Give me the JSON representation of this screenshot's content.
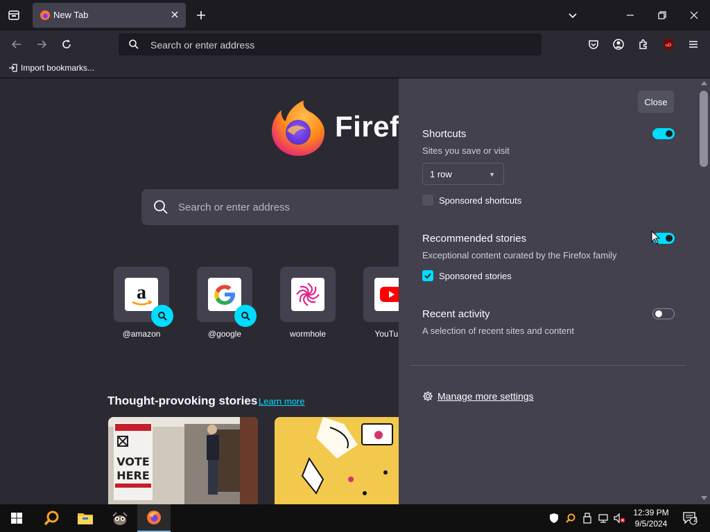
{
  "tab": {
    "title": "New Tab"
  },
  "urlbar": {
    "placeholder": "Search or enter address"
  },
  "bookmarks": {
    "import_label": "Import bookmarks..."
  },
  "newtab": {
    "brand": "Firefox",
    "search_placeholder": "Search or enter address",
    "shortcuts": [
      {
        "label": "@amazon",
        "icon": "amazon-logo"
      },
      {
        "label": "@google",
        "icon": "google-logo"
      },
      {
        "label": "wormhole",
        "icon": "wormhole-logo"
      },
      {
        "label": "YouTube",
        "icon": "youtube-logo"
      }
    ],
    "stories": {
      "title": "Thought-provoking stories",
      "learn_more": "Learn more"
    }
  },
  "panel": {
    "close_label": "Close",
    "shortcuts": {
      "title": "Shortcuts",
      "subtitle": "Sites you save or visit",
      "rows_value": "1 row",
      "enabled": true,
      "sponsored_label": "Sponsored shortcuts",
      "sponsored_checked": false
    },
    "recommended": {
      "title": "Recommended stories",
      "subtitle": "Exceptional content curated by the Firefox family",
      "enabled": true,
      "sponsored_label": "Sponsored stories",
      "sponsored_checked": true
    },
    "recent": {
      "title": "Recent activity",
      "subtitle": "A selection of recent sites and content",
      "enabled": false
    },
    "manage_label": "Manage more settings"
  },
  "taskbar": {
    "time": "12:39 PM",
    "date": "9/5/2024",
    "notification_count": "2"
  },
  "colors": {
    "accent": "#00ddff",
    "panel_bg": "#42414d",
    "page_bg": "#2b2a33"
  }
}
